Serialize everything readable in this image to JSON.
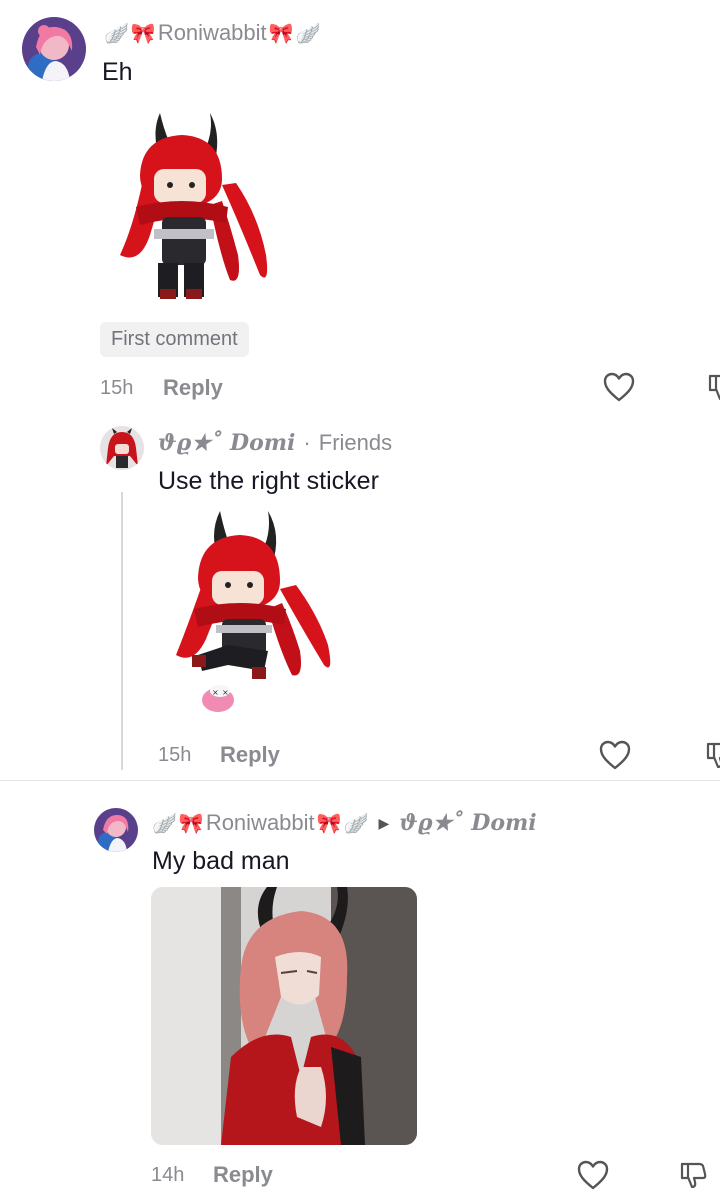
{
  "comment1": {
    "username": "Roniwabbit",
    "text": "Eh",
    "chip": "First comment",
    "time": "15h",
    "reply_label": "Reply"
  },
  "comment2": {
    "username_prefix": "ϑϱ★˚",
    "username": "Domi",
    "separator": "·",
    "relation": "Friends",
    "text": "Use the right sticker",
    "time": "15h",
    "reply_label": "Reply"
  },
  "comment3": {
    "username": "Roniwabbit",
    "reply_to_prefix": "ϑϱ★˚",
    "reply_to": "Domi",
    "text": "My bad man",
    "time": "14h",
    "reply_label": "Reply"
  },
  "colors": {
    "text": "#161823",
    "muted": "#8a8b91",
    "chip_bg": "#f1f1f2",
    "sticker_red": "#d6121b",
    "bow_pink": "#e8405e"
  },
  "icons": [
    "heart-icon",
    "dislike-icon",
    "bow-icon",
    "wing-icon",
    "reply-arrow-icon"
  ]
}
